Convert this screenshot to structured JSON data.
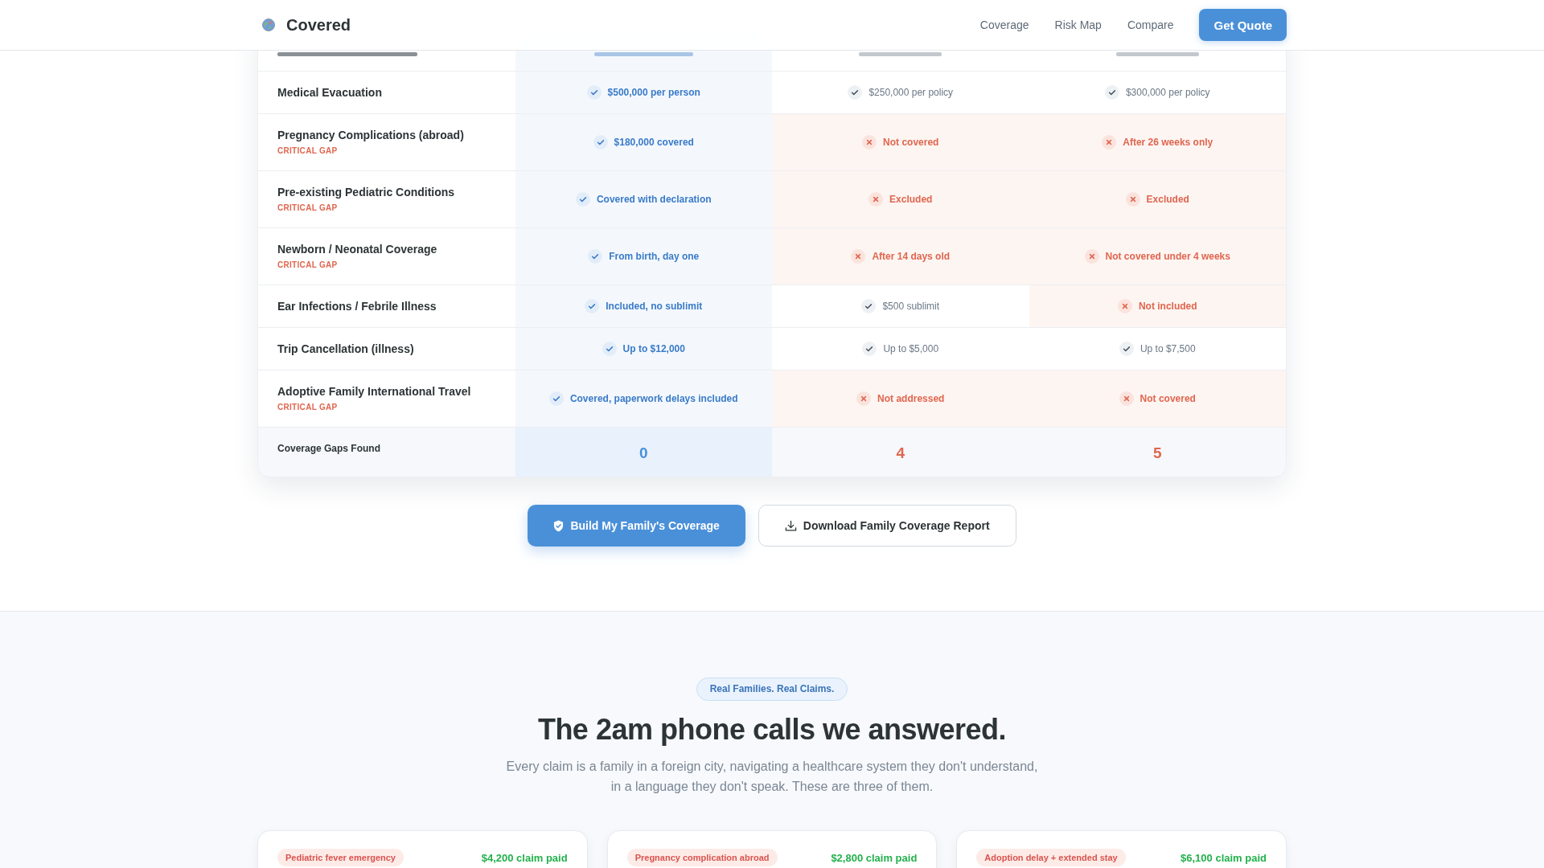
{
  "header": {
    "brand": "Covered",
    "nav": [
      "Coverage",
      "Risk Map",
      "Compare"
    ],
    "cta": "Get Quote"
  },
  "comparison": {
    "rows": [
      {
        "label": "Medical Evacuation",
        "cells": [
          {
            "kind": "covered",
            "text": "$500,000 per person"
          },
          {
            "kind": "limited",
            "text": "$250,000 per policy"
          },
          {
            "kind": "limited",
            "text": "$300,000 per policy"
          }
        ]
      },
      {
        "label": "Pregnancy Complications (abroad)",
        "tag": "CRITICAL GAP",
        "cells": [
          {
            "kind": "covered",
            "text": "$180,000 covered"
          },
          {
            "kind": "excluded",
            "text": "Not covered"
          },
          {
            "kind": "excluded",
            "text": "After 26 weeks only"
          }
        ]
      },
      {
        "label": "Pre-existing Pediatric Conditions",
        "tag": "CRITICAL GAP",
        "cells": [
          {
            "kind": "covered",
            "text": "Covered with declaration"
          },
          {
            "kind": "excluded",
            "text": "Excluded"
          },
          {
            "kind": "excluded",
            "text": "Excluded"
          }
        ]
      },
      {
        "label": "Newborn / Neonatal Coverage",
        "tag": "CRITICAL GAP",
        "cells": [
          {
            "kind": "covered",
            "text": "From birth, day one"
          },
          {
            "kind": "excluded",
            "text": "After 14 days old"
          },
          {
            "kind": "excluded",
            "text": "Not covered under 4 weeks"
          }
        ]
      },
      {
        "label": "Ear Infections / Febrile Illness",
        "cells": [
          {
            "kind": "covered",
            "text": "Included, no sublimit"
          },
          {
            "kind": "limited",
            "text": "$500 sublimit"
          },
          {
            "kind": "excluded",
            "text": "Not included"
          }
        ]
      },
      {
        "label": "Trip Cancellation (illness)",
        "cells": [
          {
            "kind": "covered",
            "text": "Up to $12,000"
          },
          {
            "kind": "limited",
            "text": "Up to $5,000"
          },
          {
            "kind": "limited",
            "text": "Up to $7,500"
          }
        ]
      },
      {
        "label": "Adoptive Family International Travel",
        "tag": "CRITICAL GAP",
        "cells": [
          {
            "kind": "covered",
            "text": "Covered, paperwork delays included"
          },
          {
            "kind": "excluded",
            "text": "Not addressed"
          },
          {
            "kind": "excluded",
            "text": "Not covered"
          }
        ]
      }
    ],
    "summary": {
      "label": "Coverage Gaps Found",
      "values": [
        {
          "kind": "clear",
          "text": "0"
        },
        {
          "kind": "gaps",
          "text": "4"
        },
        {
          "kind": "gaps",
          "text": "5"
        }
      ]
    }
  },
  "actions": [
    {
      "kind": "primary",
      "label": "Build My Family's Coverage"
    },
    {
      "kind": "secondary",
      "label": "Download Family Coverage Report"
    }
  ],
  "claims": {
    "badge": "Real Families. Real Claims.",
    "title": "The 2am phone calls we answered.",
    "intro": "Every claim is a family in a foreign city, navigating a healthcare system they don't understand, in a language they don't speak. These are three of them.",
    "cards": [
      {
        "tag": "Pediatric fever emergency",
        "amount": "$4,200 claim paid"
      },
      {
        "tag": "Pregnancy complication abroad",
        "amount": "$2,800 claim paid"
      },
      {
        "tag": "Adoption delay + extended stay",
        "amount": "$6,100 claim paid"
      }
    ]
  }
}
